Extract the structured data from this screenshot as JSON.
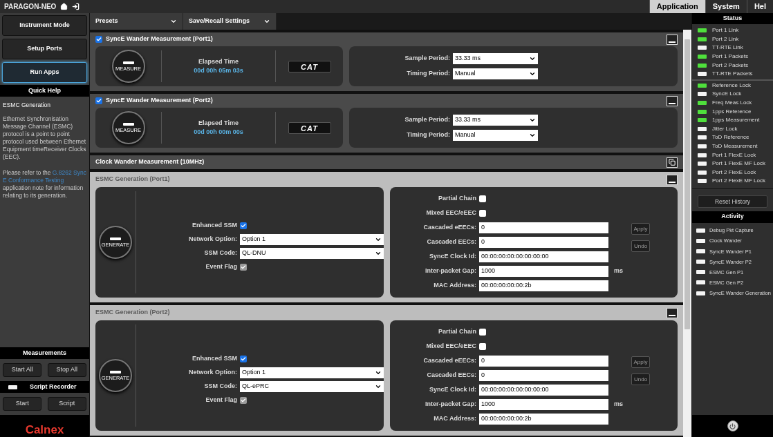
{
  "app_title": "PARAGON-NEO",
  "top_tabs": [
    {
      "label": "Application",
      "selected": true
    },
    {
      "label": "System",
      "selected": false
    },
    {
      "label": "Hel",
      "selected": false
    }
  ],
  "nav_buttons": [
    {
      "label": "Instrument Mode",
      "selected": false
    },
    {
      "label": "Setup Ports",
      "selected": false
    },
    {
      "label": "Run Apps",
      "selected": true
    }
  ],
  "quick_help": {
    "title": "Quick Help",
    "heading": "ESMC Generation",
    "paragraph": "Ethernet Synchronisation Message Channel (ESMC) protocol is a point to point protocol used between Ethernet Equipment timeReceiver Clocks (EEC).",
    "note_before": "Please refer to the ",
    "note_link": "G.8262 Sync E Conformance Testing",
    "note_after": " application note for information relating to its generation."
  },
  "measurements": {
    "title": "Measurements",
    "buttons": [
      "Start All",
      "Stop All"
    ]
  },
  "script_recorder": {
    "title": "Script Recorder",
    "recording": false,
    "buttons": [
      "Start",
      "Script"
    ]
  },
  "logo": "Calnex",
  "toolbar_menus": [
    "Presets",
    "Save/Recall Settings"
  ],
  "panels": [
    {
      "kind": "measure",
      "title": "SyncE Wander Measurement (Port1)",
      "checked": true,
      "button": "MEASURE",
      "elapsed_label": "Elapsed Time",
      "elapsed": "00d 00h 05m 03s",
      "cat": "CAT",
      "fields": [
        {
          "label": "Sample Period:",
          "value": "33.33 ms"
        },
        {
          "label": "Timing Period:",
          "value": "Manual"
        }
      ]
    },
    {
      "kind": "measure",
      "title": "SyncE Wander Measurement (Port2)",
      "checked": true,
      "button": "MEASURE",
      "elapsed_label": "Elapsed Time",
      "elapsed": "00d 00h 00m 00s",
      "cat": "CAT",
      "fields": [
        {
          "label": "Sample Period:",
          "value": "33.33 ms"
        },
        {
          "label": "Timing Period:",
          "value": "Manual"
        }
      ]
    },
    {
      "kind": "collapsed",
      "title": "Clock Wander Measurement (10MHz)"
    },
    {
      "kind": "esmc",
      "title": "ESMC Generation (Port1)",
      "button": "GENERATE",
      "left_rows": [
        {
          "kind": "checkbox",
          "label": "Enhanced SSM",
          "checked": true,
          "disabled": false
        },
        {
          "kind": "select",
          "label": "Network Option:",
          "value": "Option 1"
        },
        {
          "kind": "select",
          "label": "SSM Code:",
          "value": "QL-DNU"
        },
        {
          "kind": "checkbox",
          "label": "Event Flag",
          "checked": true,
          "disabled": true
        }
      ],
      "right_rows": [
        {
          "kind": "checkbox",
          "label": "Partial Chain",
          "checked": false,
          "disabled": false
        },
        {
          "kind": "checkbox",
          "label": "Mixed EEC/eEEC",
          "checked": false,
          "disabled": false
        },
        {
          "kind": "input",
          "label": "Cascaded eEECs:",
          "value": "0"
        },
        {
          "kind": "input",
          "label": "Cascaded EECs:",
          "value": "0"
        },
        {
          "kind": "input",
          "label": "SyncE Clock Id:",
          "value": "00:00:00:00:00:00:00:00"
        },
        {
          "kind": "input",
          "label": "Inter-packet Gap:",
          "value": "1000",
          "unit": "ms"
        },
        {
          "kind": "input",
          "label": "MAC Address:",
          "value": "00:00:00:00:00:2b"
        }
      ],
      "actions": [
        "Apply",
        "Undo"
      ]
    },
    {
      "kind": "esmc",
      "title": "ESMC Generation (Port2)",
      "button": "GENERATE",
      "left_rows": [
        {
          "kind": "checkbox",
          "label": "Enhanced SSM",
          "checked": true,
          "disabled": false
        },
        {
          "kind": "select",
          "label": "Network Option:",
          "value": "Option 1"
        },
        {
          "kind": "select",
          "label": "SSM Code:",
          "value": "QL-ePRC"
        },
        {
          "kind": "checkbox",
          "label": "Event Flag",
          "checked": true,
          "disabled": true
        }
      ],
      "right_rows": [
        {
          "kind": "checkbox",
          "label": "Partial Chain",
          "checked": false,
          "disabled": false
        },
        {
          "kind": "checkbox",
          "label": "Mixed EEC/eEEC",
          "checked": false,
          "disabled": false
        },
        {
          "kind": "input",
          "label": "Cascaded eEECs:",
          "value": "0"
        },
        {
          "kind": "input",
          "label": "Cascaded EECs:",
          "value": "0"
        },
        {
          "kind": "input",
          "label": "SyncE Clock Id:",
          "value": "00:00:00:00:00:00:00:00"
        },
        {
          "kind": "input",
          "label": "Inter-packet Gap:",
          "value": "1000",
          "unit": "ms"
        },
        {
          "kind": "input",
          "label": "MAC Address:",
          "value": "00:00:00:00:00:2b"
        }
      ],
      "actions": [
        "Apply",
        "Undo"
      ]
    }
  ],
  "status": {
    "title": "Status",
    "groups": [
      [
        {
          "label": "Port 1 Link",
          "on": true
        },
        {
          "label": "Port 2 Link",
          "on": true
        },
        {
          "label": "TT-RTE Link",
          "on": false
        },
        {
          "label": "Port 1 Packets",
          "on": true
        },
        {
          "label": "Port 2 Packets",
          "on": true
        },
        {
          "label": "TT-RTE Packets",
          "on": false
        }
      ],
      [
        {
          "label": "Reference Lock",
          "on": true
        },
        {
          "label": "SyncE Lock",
          "on": false
        },
        {
          "label": "Freq Meas Lock",
          "on": true
        },
        {
          "label": "1pps Reference",
          "on": true
        },
        {
          "label": "1pps Measurement",
          "on": true
        },
        {
          "label": "Jitter Lock",
          "on": false
        },
        {
          "label": "ToD Reference",
          "on": false
        },
        {
          "label": "ToD Measurement",
          "on": false
        },
        {
          "label": "Port 1 FlexE Lock",
          "on": false
        },
        {
          "label": "Port 1 FlexE MF Lock",
          "on": false
        },
        {
          "label": "Port 2 FlexE Lock",
          "on": false
        },
        {
          "label": "Port 2 FlexE MF Lock",
          "on": false
        }
      ]
    ],
    "reset_button": "Reset History"
  },
  "activity": {
    "title": "Activity",
    "items": [
      {
        "label": "Debug Pkt Capture",
        "on": false
      },
      {
        "label": "Clock Wander",
        "on": false
      },
      {
        "label": "SyncE Wander P1",
        "on": false
      },
      {
        "label": "SyncE Wander P2",
        "on": false
      },
      {
        "label": "ESMC Gen P1",
        "on": false
      },
      {
        "label": "ESMC Gen P2",
        "on": false
      },
      {
        "label": "SyncE Wander Generation",
        "on": false
      }
    ]
  }
}
